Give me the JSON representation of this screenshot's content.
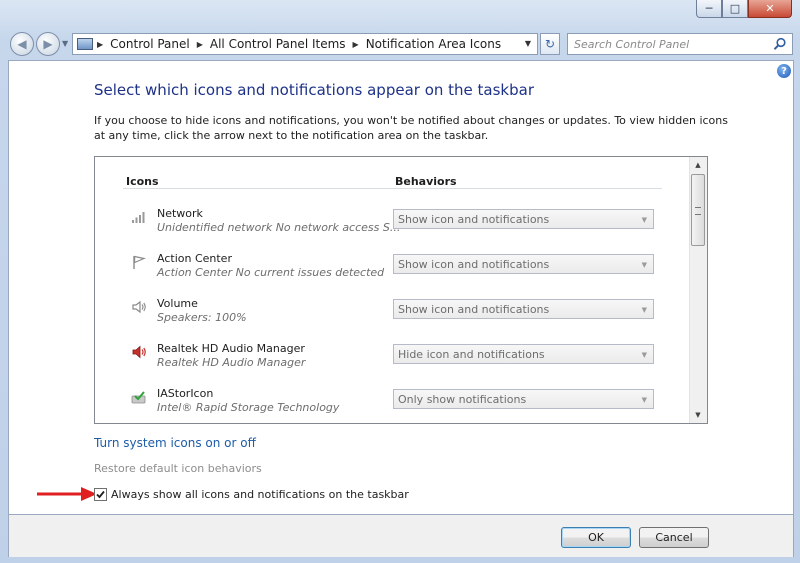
{
  "window": {
    "caption_buttons": [
      "minimize-icon",
      "maximize-icon",
      "close-icon"
    ]
  },
  "address_bar": {
    "breadcrumbs": [
      "Control Panel",
      "All Control Panel Items",
      "Notification Area Icons"
    ]
  },
  "search": {
    "placeholder": "Search Control Panel"
  },
  "main": {
    "title": "Select which icons and notifications appear on the taskbar",
    "description": "If you choose to hide icons and notifications, you won't be notified about changes or updates. To view hidden icons at any time, click the arrow next to the notification area on the taskbar.",
    "columns": {
      "icons": "Icons",
      "behaviors": "Behaviors"
    },
    "rows": [
      {
        "name": "Network",
        "subtitle": "Unidentified network No network access S...",
        "behavior": "Show icon and notifications",
        "icon": "network-icon"
      },
      {
        "name": "Action Center",
        "subtitle": "Action Center  No current issues detected",
        "behavior": "Show icon and notifications",
        "icon": "flag-icon"
      },
      {
        "name": "Volume",
        "subtitle": "Speakers: 100%",
        "behavior": "Show icon and notifications",
        "icon": "speaker-icon"
      },
      {
        "name": "Realtek HD Audio Manager",
        "subtitle": "Realtek HD Audio Manager",
        "behavior": "Hide icon and notifications",
        "icon": "red-speaker-icon"
      },
      {
        "name": "IAStorIcon",
        "subtitle": "Intel® Rapid Storage Technology",
        "behavior": "Only show notifications",
        "icon": "storage-check-icon"
      }
    ],
    "turn_system_icons_link": "Turn system icons on or off",
    "restore_defaults": "Restore default icon behaviors",
    "always_show_label": "Always show all icons and notifications on the taskbar",
    "always_show_checked": true
  },
  "footer": {
    "ok_label": "OK",
    "cancel_label": "Cancel"
  },
  "colors": {
    "title_blue": "#1e3287",
    "link_blue": "#1c5ca8",
    "annotation_arrow": "#e02020"
  }
}
